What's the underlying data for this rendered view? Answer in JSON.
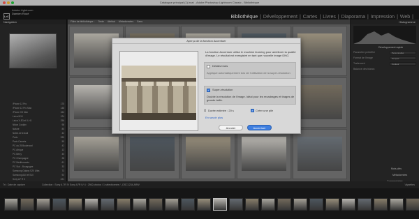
{
  "window": {
    "title": "Catalogue principal (1).lrcat - Adobe Photoshop Lightroom Classic - Bibliothèque"
  },
  "identity": {
    "logo": "LrC",
    "user_line1": "Adobe Lightroom",
    "user_line2": "Damien Roué"
  },
  "modules": [
    "Bibliothèque",
    "|",
    "Développement",
    "|",
    "Cartes",
    "|",
    "Livres",
    "|",
    "Diaporama",
    "|",
    "Impression",
    "|",
    "Web",
    "|"
  ],
  "left_panel": {
    "navigator_label": "Navigation",
    "folders": [
      {
        "name": "iPhone 12 Pro",
        "count": "175"
      },
      {
        "name": "iPhone 12 Pro Max",
        "count": "148"
      },
      {
        "name": "iPhone XS Max",
        "count": "164"
      },
      {
        "name": "Leica M10",
        "count": "124"
      },
      {
        "name": "Leica X-E3 et X-H1",
        "count": "256"
      },
      {
        "name": "Nikon Coolpix",
        "count": "98"
      },
      {
        "name": "Nature",
        "count": "80"
      },
      {
        "name": "Notes de travail",
        "count": "42"
      },
      {
        "name": "Paris",
        "count": "330"
      },
      {
        "name": "Paris Carnets",
        "count": "55"
      },
      {
        "name": "PC du 25 Boulevard",
        "count": "42"
      },
      {
        "name": "PC Afrique",
        "count": "12"
      },
      {
        "name": "PC Berry",
        "count": "40"
      },
      {
        "name": "PC Champagne",
        "count": "28"
      },
      {
        "name": "PC Méditerranée",
        "count": "61"
      },
      {
        "name": "PC Sud - Bourgogne",
        "count": "33"
      },
      {
        "name": "Samsung Galaxy S20 Ultra",
        "count": "73"
      },
      {
        "name": "Samsung A40 et S10",
        "count": "92"
      },
      {
        "name": "Sony A7 R II",
        "count": "221"
      },
      {
        "name": "Sony A7R III",
        "count": "184"
      },
      {
        "name": "Sony A6400 et ZV1",
        "count": "58"
      },
      {
        "name": "Sony A7R II et A7R V",
        "count": "117"
      },
      {
        "name": "Sony A7 IV",
        "count": "46"
      },
      {
        "name": "Sony A7R IV 4",
        "count": "2562"
      }
    ],
    "import_label": "Importer...",
    "export_label": "Exporter..."
  },
  "filter_bar": {
    "label": "Filtre de bibliothèque :",
    "items": [
      "Texte",
      "Attribut",
      "Métadonnées",
      "Sans"
    ]
  },
  "right_panel": {
    "histogram_label": "Histogramme",
    "quick_develop": "Développement rapide",
    "preset_label": "Paramètre prédéfini",
    "preset_value": "Personnalisé",
    "ratio_label": "Format de l'image",
    "ratio_value": "Tel quel",
    "treatment_label": "Traitement",
    "treatment_value": "Couleur",
    "wb_label": "Balance des blancs",
    "keywords_label": "Mots-clés",
    "metadata_label": "Métadonnées",
    "comments_label": "Commentaires",
    "sync_button": "Synchroniser",
    "sync_settings_button": "Synchr. métadonnées"
  },
  "toolbar": {
    "sort": "Tri : Date de capture",
    "status": "Collection : Sony A 7R IV Sony A7R IV 4 · 2562 photos / 1 sélectionnée / _DSC1234.ARW",
    "thumbs": "Vignettes"
  },
  "dialog": {
    "title": "Aperçu de la fonction Accentuer",
    "intro": "La fonction Accentuer utilise le machine learning pour améliorer la qualité d'image. Le résultat est enregistré en tant que nouvelle image DNG.",
    "raw_details_label": "Détails bruts",
    "raw_details_desc": "Appliqué automatiquement lors de l'utilisation de la super-résolution",
    "super_res_label": "Super-résolution",
    "super_res_desc": "Double la résolution de l'image. Idéal pour les recadrages et tirages de grande taille.",
    "duration": "Durée estimée : 20 s",
    "create_stack": "Créer une pile",
    "learn_more": "En savoir plus",
    "cancel": "Annuler",
    "enhance": "Accentuer"
  },
  "colors": {
    "accent": "#3f7fe0",
    "panel": "#2b2b2b",
    "grid": "#6a6a6a"
  }
}
